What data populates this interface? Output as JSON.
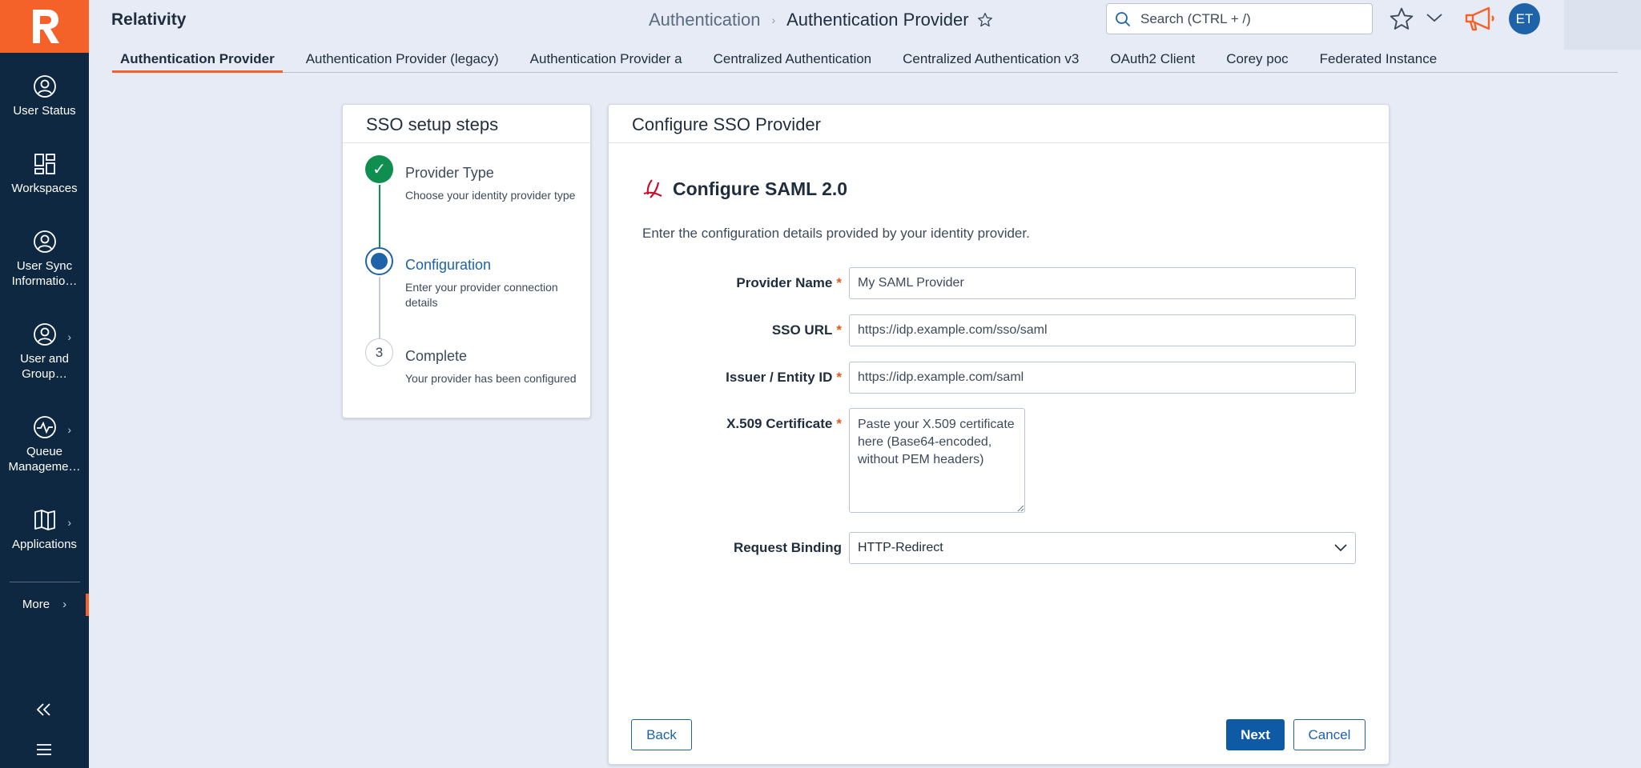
{
  "app": {
    "title": "Relativity"
  },
  "sidebar": {
    "items": [
      {
        "label": "User Status",
        "icon": "user-circle-icon"
      },
      {
        "label": "Workspaces",
        "icon": "workspaces-grid-icon"
      },
      {
        "label": "User Sync\nInformatio…",
        "icon": "user-circle-icon"
      },
      {
        "label": "User and\nGroup…",
        "icon": "user-circle-icon"
      },
      {
        "label": "Queue\nManageme…",
        "icon": "pulse-icon"
      },
      {
        "label": "Applications",
        "icon": "book-icon"
      }
    ],
    "more_label": "More"
  },
  "header": {
    "breadcrumb_parent": "Authentication",
    "breadcrumb_separator": "›",
    "breadcrumb_current": "Authentication Provider",
    "search_placeholder": "Search (CTRL + /)",
    "avatar_initials": "ET"
  },
  "tabs": [
    "Authentication Provider",
    "Authentication Provider (legacy)",
    "Authentication Provider a",
    "Centralized Authentication",
    "Centralized Authentication v3",
    "OAuth2 Client",
    "Corey poc",
    "Federated Instance"
  ],
  "steps_card": {
    "title": "SSO setup steps",
    "steps": [
      {
        "title": "Provider Type",
        "desc": "Choose your identity provider type",
        "state": "complete"
      },
      {
        "title": "Configuration",
        "desc": "Enter your provider connection details",
        "state": "current"
      },
      {
        "number": "3",
        "title": "Complete",
        "desc": "Your provider has been configured",
        "state": "pending"
      }
    ]
  },
  "form": {
    "card_title": "Configure SSO Provider",
    "heading": "Configure SAML 2.0",
    "intro": "Enter the configuration details provided by your identity provider.",
    "required_marker": "*",
    "provider_name": {
      "label": "Provider Name",
      "value": "My SAML Provider"
    },
    "sso_url": {
      "label": "SSO URL",
      "value": "https://idp.example.com/sso/saml"
    },
    "issuer": {
      "label": "Issuer / Entity ID",
      "value": "https://idp.example.com/saml"
    },
    "certificate": {
      "label": "X.509 Certificate",
      "placeholder": "Paste your X.509 certificate here (Base64-encoded, without PEM headers)"
    },
    "binding": {
      "label": "Request Binding",
      "value": "HTTP-Redirect"
    },
    "back_label": "Back",
    "next_label": "Next",
    "cancel_label": "Cancel"
  },
  "colors": {
    "sidebar_bg": "#0e2841",
    "brand_orange": "#f4622a",
    "primary_blue": "#0f5aa5",
    "success_green": "#0f8f4f",
    "page_bg": "#e6ebf5"
  }
}
